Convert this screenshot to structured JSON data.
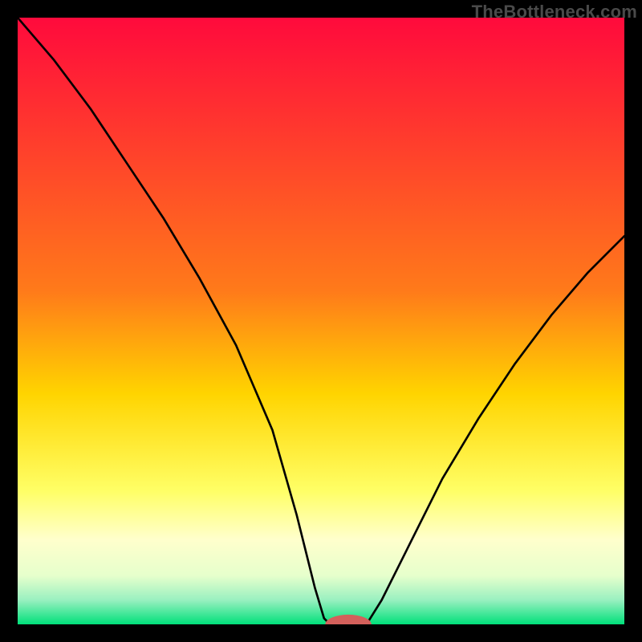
{
  "watermark": "TheBottleneck.com",
  "chart_data": {
    "type": "line",
    "title": "",
    "xlabel": "",
    "ylabel": "",
    "xlim": [
      0,
      100
    ],
    "ylim": [
      0,
      100
    ],
    "grid": false,
    "legend": false,
    "background_gradient": {
      "stops": [
        {
          "offset": 0.0,
          "color": "#ff0a3c"
        },
        {
          "offset": 0.45,
          "color": "#ff7a1a"
        },
        {
          "offset": 0.62,
          "color": "#ffd400"
        },
        {
          "offset": 0.78,
          "color": "#ffff66"
        },
        {
          "offset": 0.86,
          "color": "#ffffcc"
        },
        {
          "offset": 0.92,
          "color": "#e6ffcc"
        },
        {
          "offset": 0.96,
          "color": "#99f0c0"
        },
        {
          "offset": 1.0,
          "color": "#00e07a"
        }
      ]
    },
    "series": [
      {
        "name": "left",
        "x": [
          0,
          6,
          12,
          18,
          24,
          30,
          36,
          42,
          46,
          49,
          50.5,
          51.5
        ],
        "y": [
          100,
          93,
          85,
          76,
          67,
          57,
          46,
          32,
          18,
          6,
          1,
          0
        ]
      },
      {
        "name": "floor",
        "x": [
          51.5,
          57.5
        ],
        "y": [
          0,
          0
        ]
      },
      {
        "name": "right",
        "x": [
          57.5,
          60,
          64,
          70,
          76,
          82,
          88,
          94,
          100
        ],
        "y": [
          0,
          4,
          12,
          24,
          34,
          43,
          51,
          58,
          64
        ]
      }
    ],
    "marker": {
      "name": "min-marker",
      "x": 54.5,
      "y": 0,
      "rx": 3.8,
      "ry": 1.6,
      "color": "#d3605b"
    }
  }
}
